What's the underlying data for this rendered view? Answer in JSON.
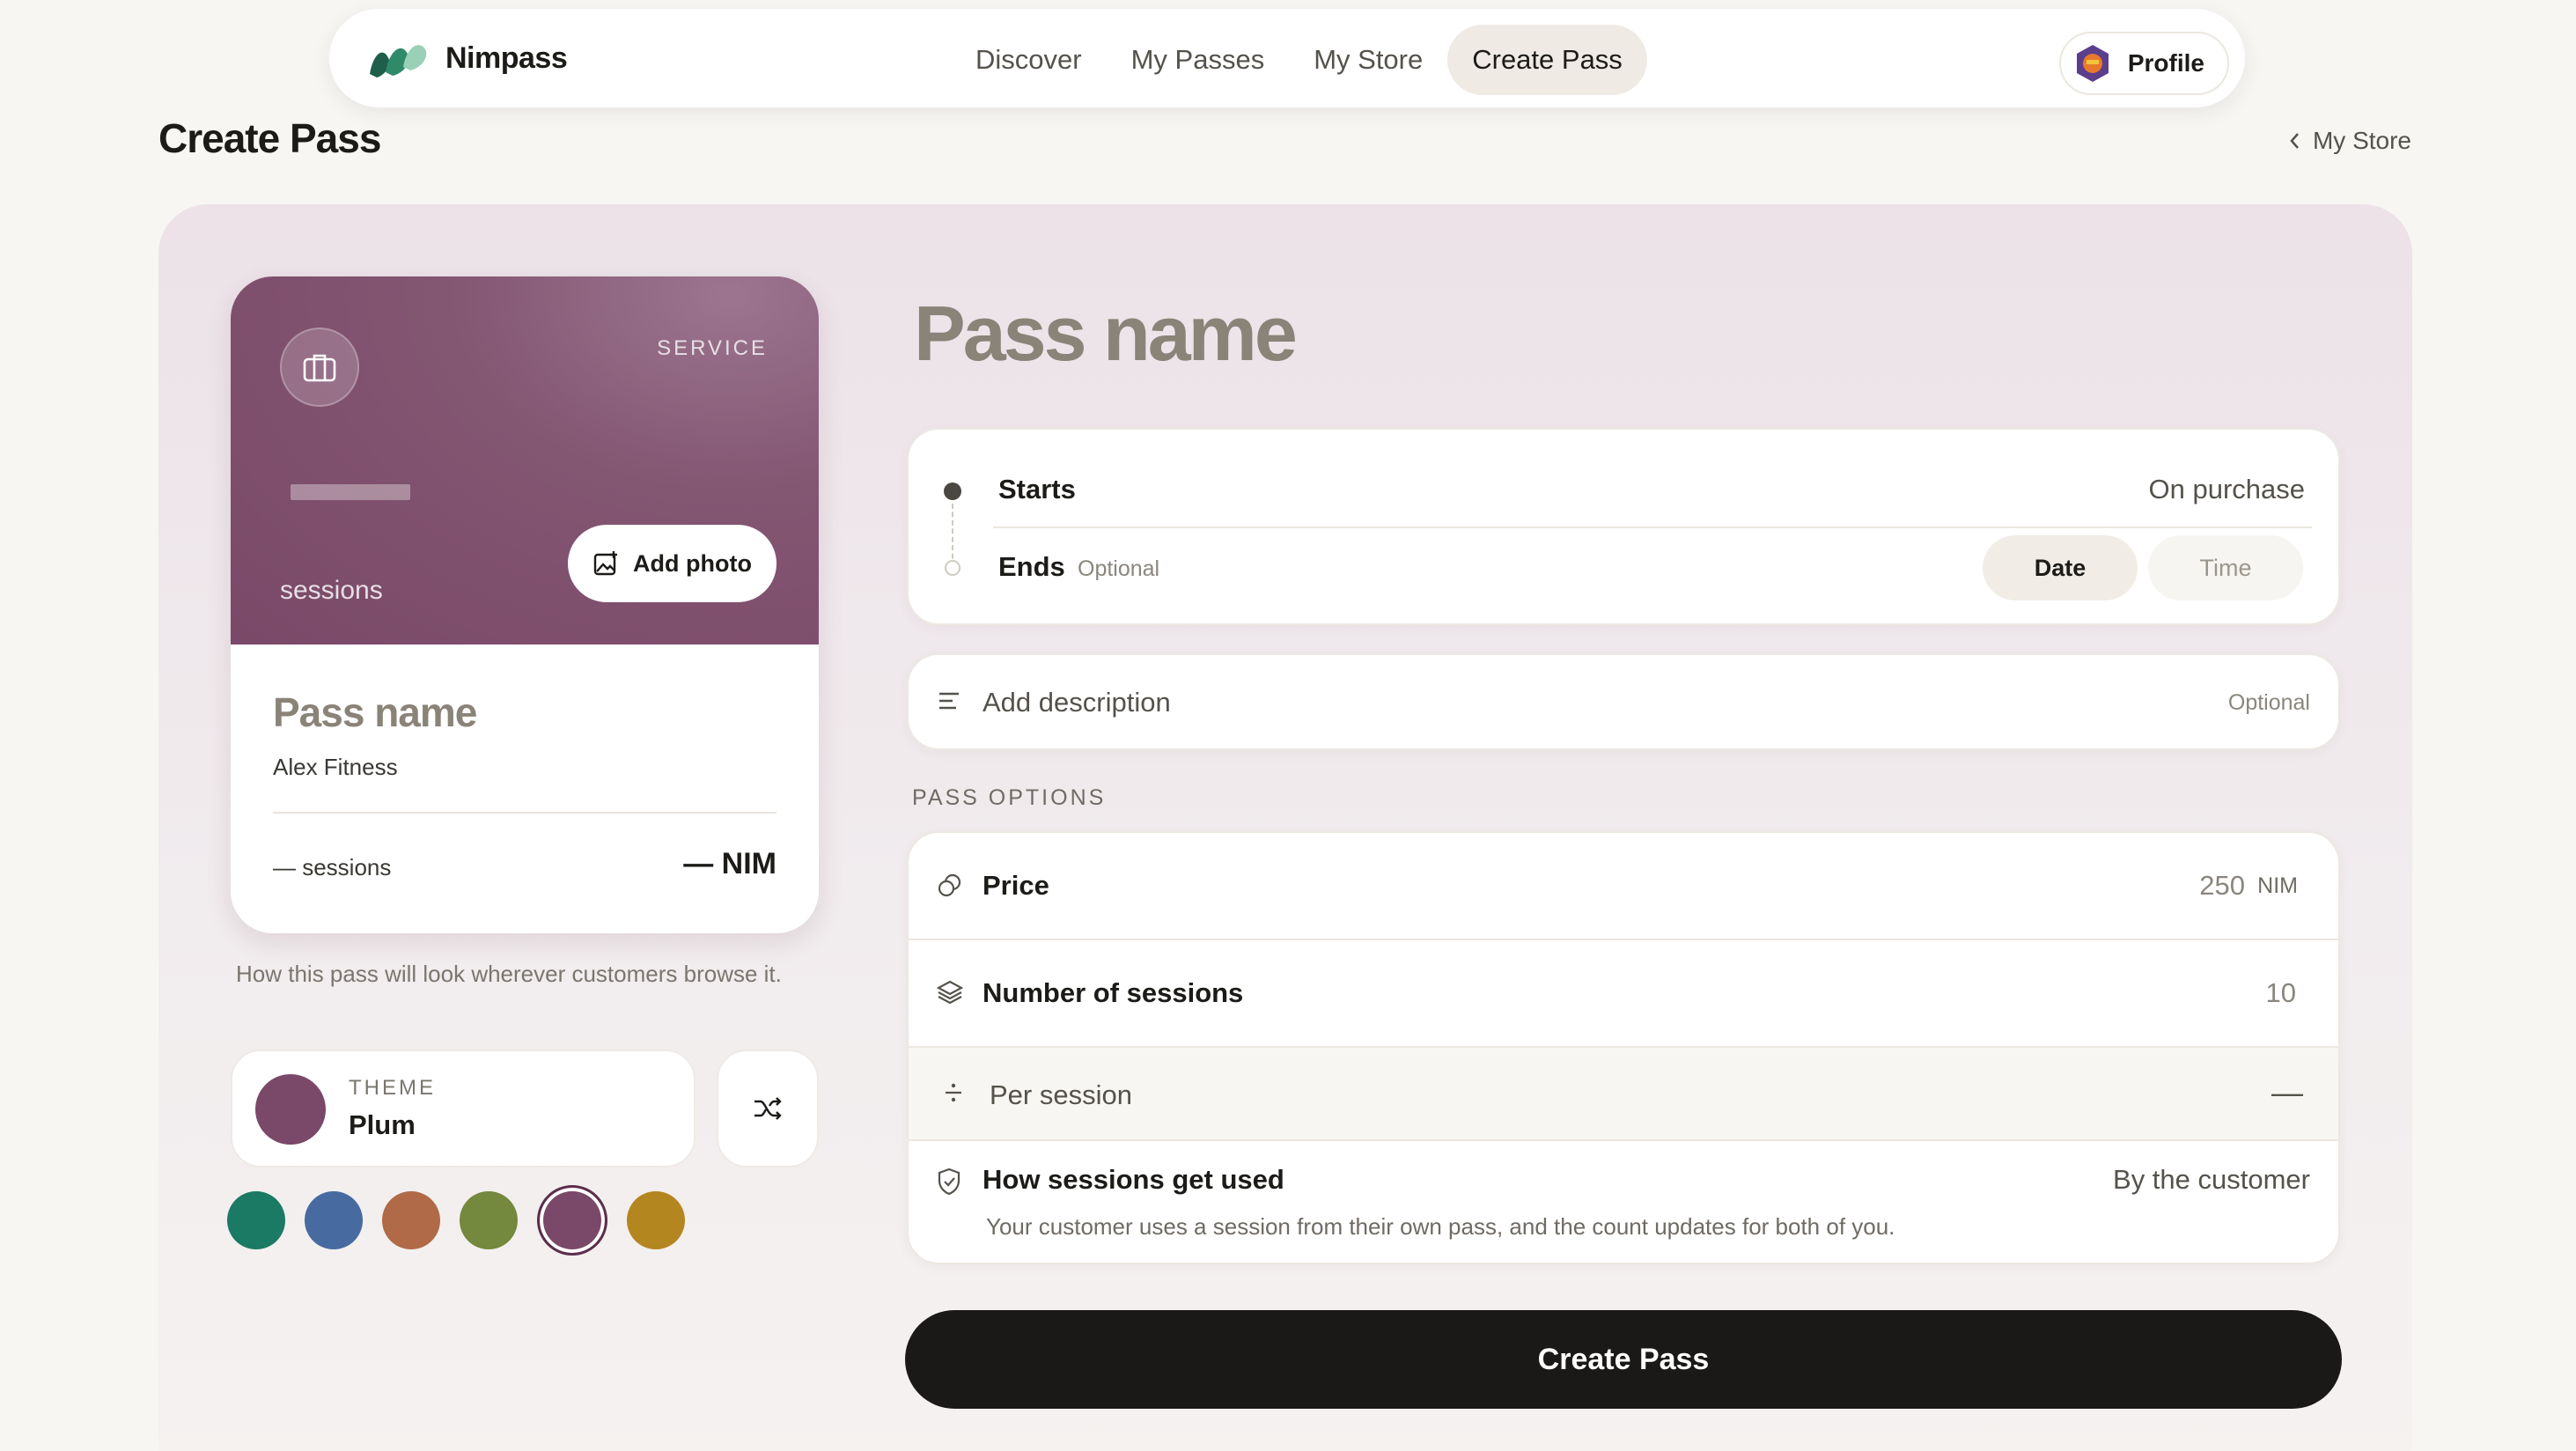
{
  "app": {
    "name": "Nimpass"
  },
  "nav": {
    "links": [
      {
        "label": "Discover"
      },
      {
        "label": "My Passes"
      },
      {
        "label": "My Store"
      },
      {
        "label": "Create Pass",
        "active": true
      }
    ],
    "profile_label": "Profile"
  },
  "header": {
    "title": "Create Pass",
    "back_label": "My Store"
  },
  "preview": {
    "kind": "SERVICE",
    "sessions_label": "sessions",
    "add_photo_label": "Add photo",
    "name": "Pass name",
    "store": "Alex Fitness",
    "count": "— sessions",
    "price": "— NIM",
    "caption": "How this pass will look wherever customers browse it."
  },
  "theme": {
    "label": "THEME",
    "value": "Plum",
    "swatches": [
      {
        "name": "teal",
        "color": "#1b7a63"
      },
      {
        "name": "blue",
        "color": "#476aa0"
      },
      {
        "name": "copper",
        "color": "#b06a48"
      },
      {
        "name": "olive",
        "color": "#74883e"
      },
      {
        "name": "plum",
        "color": "#7a4868",
        "selected": true
      },
      {
        "name": "amber",
        "color": "#b4861f"
      }
    ]
  },
  "form": {
    "title_placeholder": "Pass name",
    "starts_label": "Starts",
    "starts_value": "On purchase",
    "ends_label": "Ends",
    "ends_optional": "Optional",
    "date_label": "Date",
    "time_label": "Time",
    "description_placeholder": "Add description",
    "description_optional": "Optional",
    "options_section": "PASS OPTIONS",
    "price_label": "Price",
    "price_value": "250",
    "price_unit": "NIM",
    "sessions_label": "Number of sessions",
    "sessions_value": "10",
    "per_session_label": "Per session",
    "per_session_value": "—",
    "usage_label": "How sessions get used",
    "usage_value": "By the customer",
    "usage_desc": "Your customer uses a session from their own pass, and the count updates for both of you.",
    "submit_label": "Create Pass"
  },
  "colors": {
    "accent": "#7a4868",
    "button": "#1a1917"
  }
}
